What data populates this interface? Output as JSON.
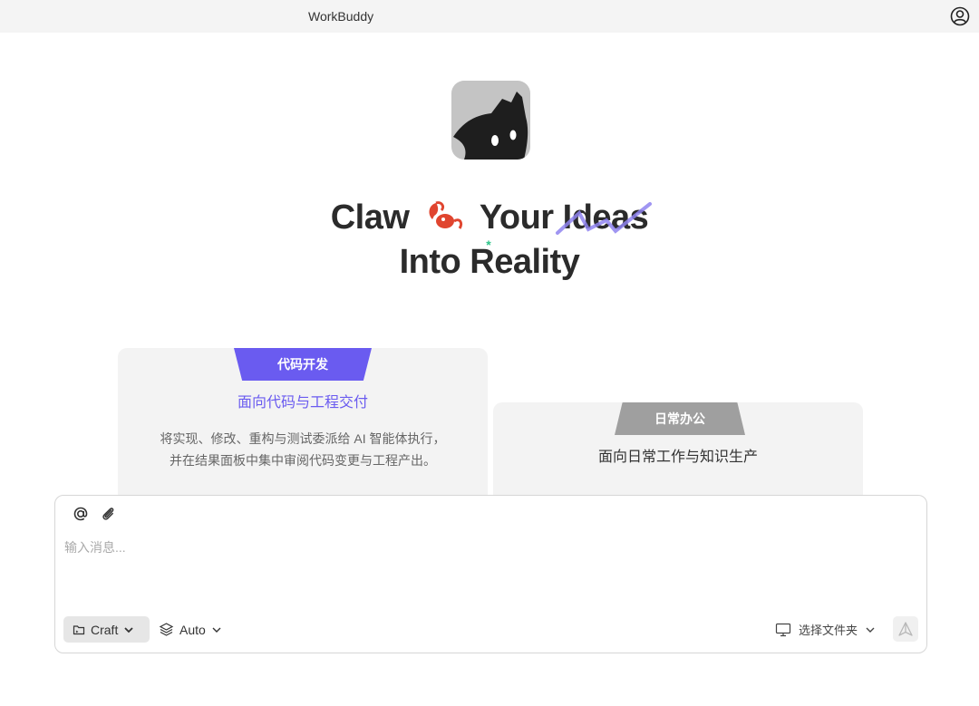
{
  "window": {
    "title": "WorkBuddy"
  },
  "icons": {
    "account": "account-circle-icon",
    "logo": "cat-logo-icon",
    "lobster": "lobster-icon",
    "mention": "at-sign-icon",
    "attach": "paperclip-icon",
    "mode": "folder-icon",
    "model": "layers-icon",
    "folder": "monitor-icon",
    "send": "send-icon"
  },
  "hero": {
    "line1_a": "Claw",
    "line1_b": "Your",
    "line1_c": "Ideas",
    "line2_a": "Into",
    "line2_b": "R",
    "line2_c": "eality"
  },
  "cards": {
    "code": {
      "tab": "代码开发",
      "title": "面向代码与工程交付",
      "desc_line1": "将实现、修改、重构与测试委派给 AI 智能体执行，",
      "desc_line2": "并在结果面板中集中审阅代码变更与工程产出。"
    },
    "daily": {
      "tab": "日常办公",
      "title": "面向日常工作与知识生产"
    }
  },
  "composer": {
    "placeholder": "输入消息...",
    "mode_label": "Craft",
    "model_label": "Auto",
    "folder_label": "选择文件夹"
  },
  "colors": {
    "accent": "#6a5bf0",
    "sparkle": "#2ec48a",
    "lobster": "#e0452f",
    "strike": "#8f84f0"
  }
}
